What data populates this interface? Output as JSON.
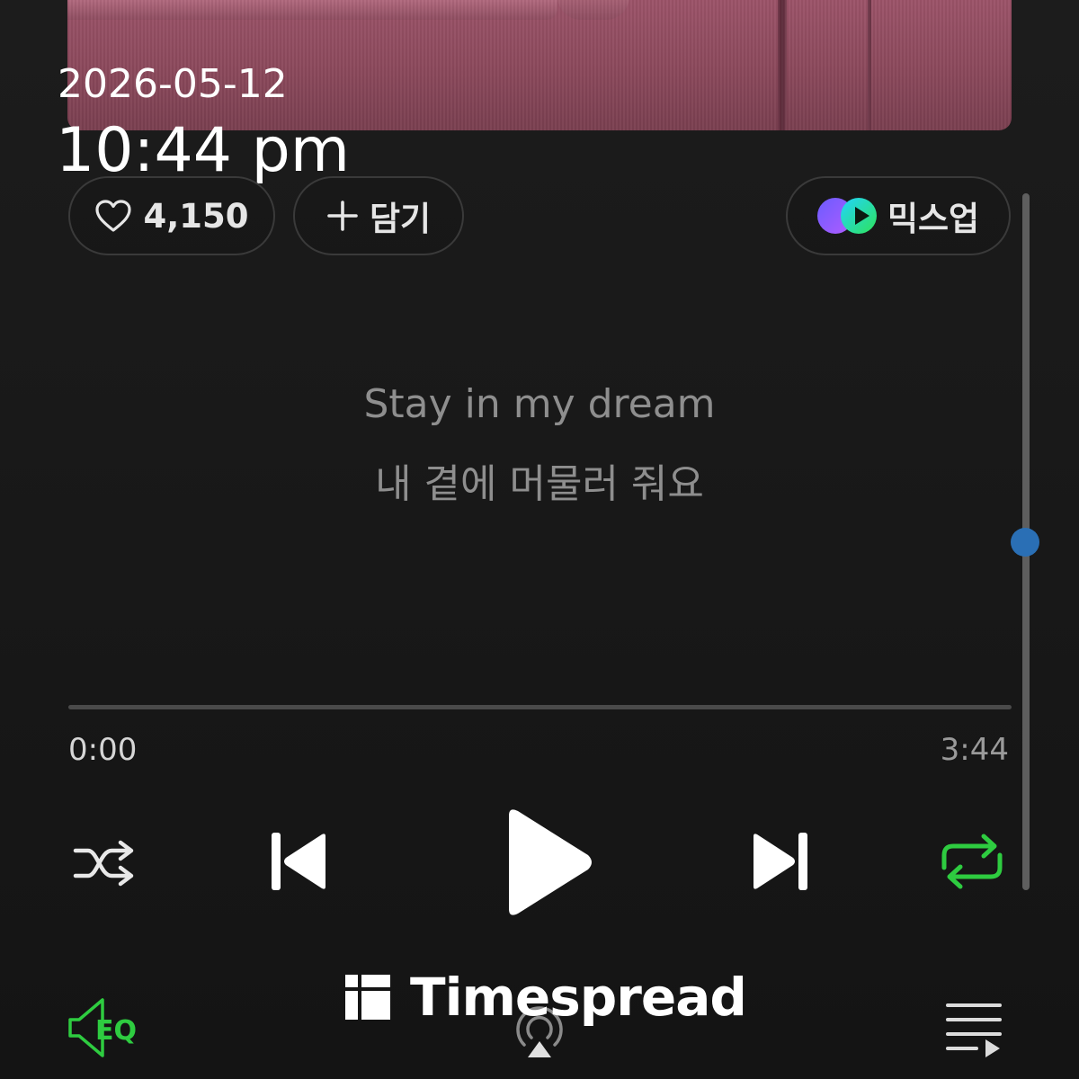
{
  "status": {
    "date": "2026-05-12",
    "time": "10:44 pm"
  },
  "actions": {
    "like_count": "4,150",
    "add_label": "담기",
    "mixup_label": "믹스업"
  },
  "lyrics": {
    "line1": "Stay in my dream",
    "line2": "내 곁에 머물러 줘요"
  },
  "player": {
    "current_time": "0:00",
    "total_time": "3:44",
    "progress": 0,
    "repeat_active": true,
    "accent_color": "#2ecc40"
  },
  "bottom": {
    "eq_label": "EQ"
  },
  "watermark": {
    "text": "Timespread"
  },
  "icons": [
    "heart-icon",
    "plus-icon",
    "mixup-logo-icon",
    "shuffle-icon",
    "previous-icon",
    "play-icon",
    "next-icon",
    "repeat-icon",
    "eq-icon",
    "airplay-icon",
    "playlist-icon"
  ]
}
